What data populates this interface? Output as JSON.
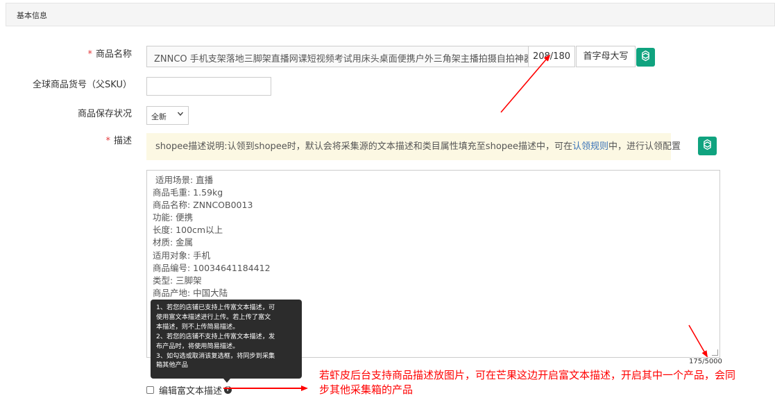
{
  "panel": {
    "title": "基本信息"
  },
  "form": {
    "title_label": "商品名称",
    "title_value": "ZNNCO 手机支架落地三脚架直播网课短视频考试用床头桌面便携户外三角架主播拍摄自拍神器",
    "title_counter": "208/180",
    "caps_button": "首字母大写",
    "sku_label": "全球商品货号（父SKU）",
    "sku_value": "",
    "condition_label": "商品保存状况",
    "condition_value": "全新",
    "description_label": "描述",
    "required_mark": "*"
  },
  "notice": {
    "text_before": "shopee描述说明:认领到shopee时，默认会将采集源的文本描述和类目属性填充至shopee描述中，可在",
    "link": "认领规则",
    "text_after": "中，进行认领配置"
  },
  "description": {
    "lines": [
      " 适用场景: 直播",
      "商品毛重: 1.59kg",
      "商品名称: ZNNCOB0013",
      "功能: 便携",
      "长度: 100cm以上",
      "材质: 金属",
      "适用对象: 手机",
      "商品编号: 10034641184412",
      "类型: 三脚架",
      "商品产地: 中国大陆"
    ],
    "char_count": "175/5000"
  },
  "tooltip": {
    "lines": [
      "1、若您的店铺已支持上传富文本描述，可",
      "使用富文本描述进行上传。若上传了富文",
      "本描述，则不上传简易描述。",
      "2、若您的店铺不支持上传富文本描述，发",
      "布产品时，将使用简易描述。",
      "3、如勾选或取消该复选框，将同步到采集",
      "箱其他产品"
    ]
  },
  "rich_text": {
    "label": "编辑富文本描述",
    "help": "?"
  },
  "annotation": {
    "lines": [
      "若虾皮后台支持商品描述放图片，可在芒果这边开启富文本描述，开启其中一个产品，会同",
      "步其他采集箱的产品"
    ]
  },
  "icons": {
    "gpt": "openai-logo-icon",
    "caret": "chevron-down-icon",
    "help": "question-circle-icon"
  },
  "colors": {
    "required": "#e4393c",
    "gpt": "#10a37f",
    "notice_bg": "#fcf8e3",
    "link": "#3a73b8",
    "annotation": "#ff0000"
  }
}
